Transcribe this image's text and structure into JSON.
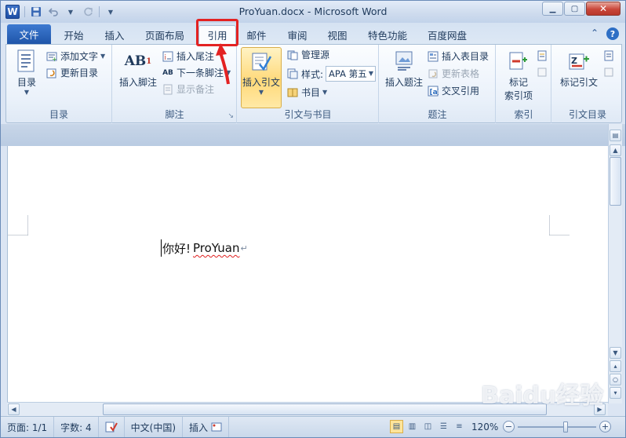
{
  "window": {
    "title": "ProYuan.docx - Microsoft Word",
    "app_icon_letter": "W"
  },
  "tabs": {
    "file": "文件",
    "items": [
      "开始",
      "插入",
      "页面布局",
      "引用",
      "邮件",
      "审阅",
      "视图",
      "特色功能",
      "百度网盘"
    ],
    "active": "引用"
  },
  "ribbon": {
    "toc": {
      "big": "目录",
      "add_text": "添加文字",
      "update": "更新目录",
      "label": "目录"
    },
    "footnotes": {
      "insert_footnote": "插入脚注",
      "insert_endnote": "插入尾注",
      "next_footnote": "下一条脚注",
      "show_notes": "显示备注",
      "label": "脚注",
      "ab_glyph": "AB",
      "ab_super": "1"
    },
    "citations": {
      "insert_citation": "插入引文",
      "manage_sources": "管理源",
      "style_label": "样式:",
      "style_value": "APA 第五",
      "bibliography": "书目",
      "label": "引文与书目"
    },
    "captions": {
      "insert_caption": "插入题注",
      "insert_table_figures": "插入表目录",
      "update_table": "更新表格",
      "cross_reference": "交叉引用",
      "label": "题注"
    },
    "index": {
      "mark_entry_line1": "标记",
      "mark_entry_line2": "索引项",
      "label": "索引"
    },
    "toa": {
      "mark_citation": "标记引文",
      "label": "引文目录"
    }
  },
  "document": {
    "text_cn": "你好!",
    "text_en": "ProYuan",
    "para_mark": "↵"
  },
  "statusbar": {
    "page": "页面: 1/1",
    "words": "字数: 4",
    "language": "中文(中国)",
    "mode": "插入",
    "zoom": "120%"
  },
  "watermark": "Baidu经验",
  "colors": {
    "file_tab": "#2a63b8",
    "highlight": "#e32222",
    "active_button": "#ffd97a"
  }
}
